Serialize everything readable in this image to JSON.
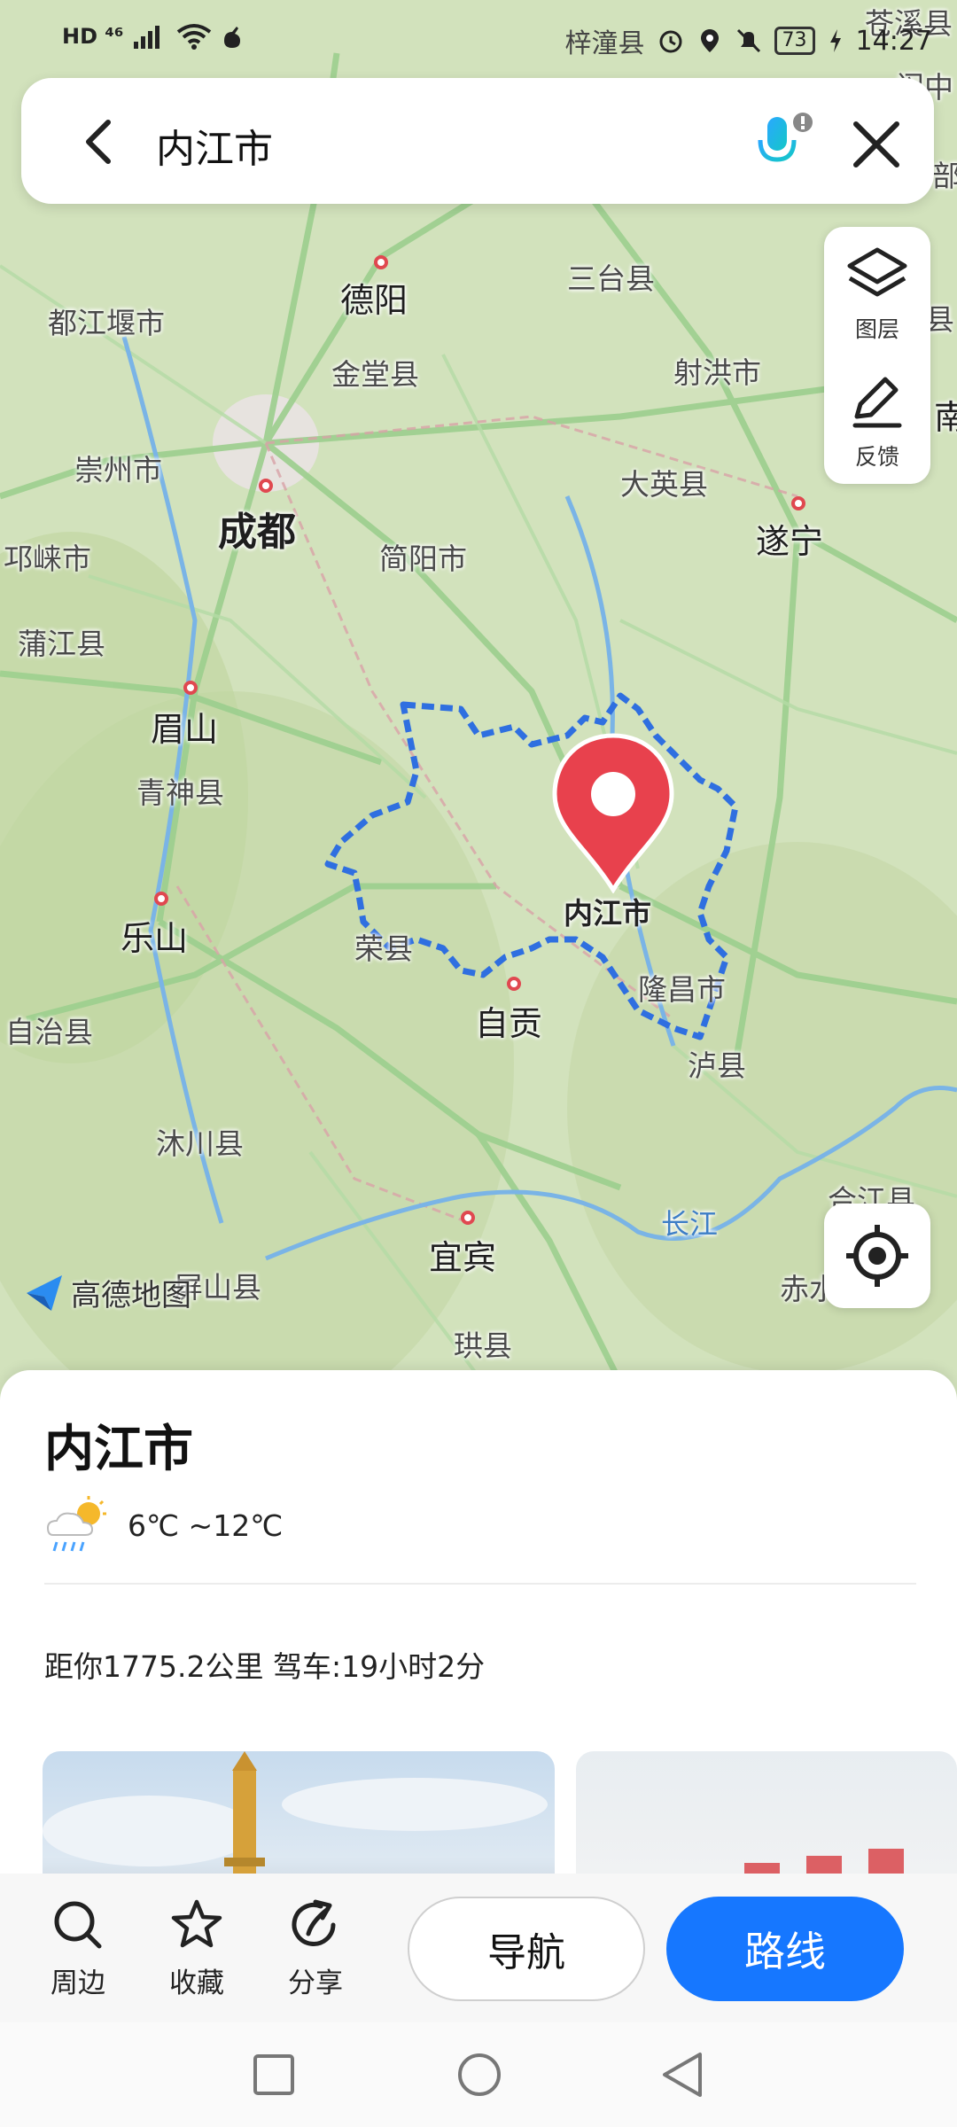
{
  "status_bar": {
    "network_badges": "HD ⁴⁶",
    "carrier_label": "梓潼县",
    "battery": "73",
    "time": "14:27"
  },
  "search": {
    "query": "内江市"
  },
  "tools": {
    "layers_label": "图层",
    "feedback_label": "反馈"
  },
  "map": {
    "provider_logo": "高德地图",
    "labels": {
      "deyang": "德阳",
      "santai": "三台县",
      "dujiangyan": "都江堰市",
      "jintang": "金堂县",
      "shehong": "射洪市",
      "chongzhou": "崇州市",
      "dayingxian": "大英县",
      "chengdu": "成都",
      "suining": "遂宁",
      "qionglai": "邛崃市",
      "jianyang": "简阳市",
      "pujiang": "蒲江县",
      "meishan": "眉山",
      "qingshen": "青神县",
      "leshan": "乐山",
      "neijiang": "内江市",
      "rongxian": "荣县",
      "longchang": "隆昌市",
      "zigong": "自贡",
      "luxian": "泸县",
      "zizhi": "自治县",
      "muchuan": "沐川县",
      "hejiang": "合江县",
      "changjiang": "长江",
      "yibin": "宜宾",
      "pingshan": "屏山县",
      "chishui": "赤水",
      "gongxian": "珙县",
      "cangxi": "苍溪县",
      "edge_zhong": "阆中",
      "edge_bu": "部",
      "edge_xian": "县",
      "edge_nan": "南"
    }
  },
  "place": {
    "title": "内江市",
    "weather": "6℃ ~12℃",
    "distance": "距你1775.2公里 驾车:19小时2分"
  },
  "actions": {
    "nearby": "周边",
    "favorite": "收藏",
    "share": "分享",
    "navigate": "导航",
    "route": "路线"
  },
  "colors": {
    "accent": "#1677ff",
    "pin": "#e8414d",
    "boundary": "#2f6fe0"
  }
}
